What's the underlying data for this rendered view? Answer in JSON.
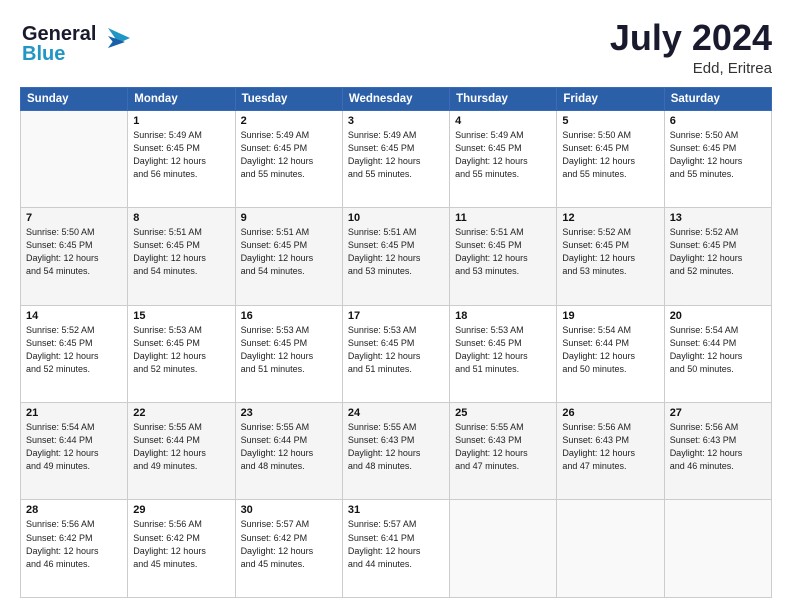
{
  "header": {
    "logo_line1": "General",
    "logo_line2": "Blue",
    "month_year": "July 2024",
    "location": "Edd, Eritrea"
  },
  "days_of_week": [
    "Sunday",
    "Monday",
    "Tuesday",
    "Wednesday",
    "Thursday",
    "Friday",
    "Saturday"
  ],
  "weeks": [
    {
      "shade": false,
      "days": [
        {
          "num": "",
          "empty": true,
          "lines": []
        },
        {
          "num": "1",
          "empty": false,
          "lines": [
            "Sunrise: 5:49 AM",
            "Sunset: 6:45 PM",
            "Daylight: 12 hours",
            "and 56 minutes."
          ]
        },
        {
          "num": "2",
          "empty": false,
          "lines": [
            "Sunrise: 5:49 AM",
            "Sunset: 6:45 PM",
            "Daylight: 12 hours",
            "and 55 minutes."
          ]
        },
        {
          "num": "3",
          "empty": false,
          "lines": [
            "Sunrise: 5:49 AM",
            "Sunset: 6:45 PM",
            "Daylight: 12 hours",
            "and 55 minutes."
          ]
        },
        {
          "num": "4",
          "empty": false,
          "lines": [
            "Sunrise: 5:49 AM",
            "Sunset: 6:45 PM",
            "Daylight: 12 hours",
            "and 55 minutes."
          ]
        },
        {
          "num": "5",
          "empty": false,
          "lines": [
            "Sunrise: 5:50 AM",
            "Sunset: 6:45 PM",
            "Daylight: 12 hours",
            "and 55 minutes."
          ]
        },
        {
          "num": "6",
          "empty": false,
          "lines": [
            "Sunrise: 5:50 AM",
            "Sunset: 6:45 PM",
            "Daylight: 12 hours",
            "and 55 minutes."
          ]
        }
      ]
    },
    {
      "shade": true,
      "days": [
        {
          "num": "7",
          "empty": false,
          "lines": [
            "Sunrise: 5:50 AM",
            "Sunset: 6:45 PM",
            "Daylight: 12 hours",
            "and 54 minutes."
          ]
        },
        {
          "num": "8",
          "empty": false,
          "lines": [
            "Sunrise: 5:51 AM",
            "Sunset: 6:45 PM",
            "Daylight: 12 hours",
            "and 54 minutes."
          ]
        },
        {
          "num": "9",
          "empty": false,
          "lines": [
            "Sunrise: 5:51 AM",
            "Sunset: 6:45 PM",
            "Daylight: 12 hours",
            "and 54 minutes."
          ]
        },
        {
          "num": "10",
          "empty": false,
          "lines": [
            "Sunrise: 5:51 AM",
            "Sunset: 6:45 PM",
            "Daylight: 12 hours",
            "and 53 minutes."
          ]
        },
        {
          "num": "11",
          "empty": false,
          "lines": [
            "Sunrise: 5:51 AM",
            "Sunset: 6:45 PM",
            "Daylight: 12 hours",
            "and 53 minutes."
          ]
        },
        {
          "num": "12",
          "empty": false,
          "lines": [
            "Sunrise: 5:52 AM",
            "Sunset: 6:45 PM",
            "Daylight: 12 hours",
            "and 53 minutes."
          ]
        },
        {
          "num": "13",
          "empty": false,
          "lines": [
            "Sunrise: 5:52 AM",
            "Sunset: 6:45 PM",
            "Daylight: 12 hours",
            "and 52 minutes."
          ]
        }
      ]
    },
    {
      "shade": false,
      "days": [
        {
          "num": "14",
          "empty": false,
          "lines": [
            "Sunrise: 5:52 AM",
            "Sunset: 6:45 PM",
            "Daylight: 12 hours",
            "and 52 minutes."
          ]
        },
        {
          "num": "15",
          "empty": false,
          "lines": [
            "Sunrise: 5:53 AM",
            "Sunset: 6:45 PM",
            "Daylight: 12 hours",
            "and 52 minutes."
          ]
        },
        {
          "num": "16",
          "empty": false,
          "lines": [
            "Sunrise: 5:53 AM",
            "Sunset: 6:45 PM",
            "Daylight: 12 hours",
            "and 51 minutes."
          ]
        },
        {
          "num": "17",
          "empty": false,
          "lines": [
            "Sunrise: 5:53 AM",
            "Sunset: 6:45 PM",
            "Daylight: 12 hours",
            "and 51 minutes."
          ]
        },
        {
          "num": "18",
          "empty": false,
          "lines": [
            "Sunrise: 5:53 AM",
            "Sunset: 6:45 PM",
            "Daylight: 12 hours",
            "and 51 minutes."
          ]
        },
        {
          "num": "19",
          "empty": false,
          "lines": [
            "Sunrise: 5:54 AM",
            "Sunset: 6:44 PM",
            "Daylight: 12 hours",
            "and 50 minutes."
          ]
        },
        {
          "num": "20",
          "empty": false,
          "lines": [
            "Sunrise: 5:54 AM",
            "Sunset: 6:44 PM",
            "Daylight: 12 hours",
            "and 50 minutes."
          ]
        }
      ]
    },
    {
      "shade": true,
      "days": [
        {
          "num": "21",
          "empty": false,
          "lines": [
            "Sunrise: 5:54 AM",
            "Sunset: 6:44 PM",
            "Daylight: 12 hours",
            "and 49 minutes."
          ]
        },
        {
          "num": "22",
          "empty": false,
          "lines": [
            "Sunrise: 5:55 AM",
            "Sunset: 6:44 PM",
            "Daylight: 12 hours",
            "and 49 minutes."
          ]
        },
        {
          "num": "23",
          "empty": false,
          "lines": [
            "Sunrise: 5:55 AM",
            "Sunset: 6:44 PM",
            "Daylight: 12 hours",
            "and 48 minutes."
          ]
        },
        {
          "num": "24",
          "empty": false,
          "lines": [
            "Sunrise: 5:55 AM",
            "Sunset: 6:43 PM",
            "Daylight: 12 hours",
            "and 48 minutes."
          ]
        },
        {
          "num": "25",
          "empty": false,
          "lines": [
            "Sunrise: 5:55 AM",
            "Sunset: 6:43 PM",
            "Daylight: 12 hours",
            "and 47 minutes."
          ]
        },
        {
          "num": "26",
          "empty": false,
          "lines": [
            "Sunrise: 5:56 AM",
            "Sunset: 6:43 PM",
            "Daylight: 12 hours",
            "and 47 minutes."
          ]
        },
        {
          "num": "27",
          "empty": false,
          "lines": [
            "Sunrise: 5:56 AM",
            "Sunset: 6:43 PM",
            "Daylight: 12 hours",
            "and 46 minutes."
          ]
        }
      ]
    },
    {
      "shade": false,
      "days": [
        {
          "num": "28",
          "empty": false,
          "lines": [
            "Sunrise: 5:56 AM",
            "Sunset: 6:42 PM",
            "Daylight: 12 hours",
            "and 46 minutes."
          ]
        },
        {
          "num": "29",
          "empty": false,
          "lines": [
            "Sunrise: 5:56 AM",
            "Sunset: 6:42 PM",
            "Daylight: 12 hours",
            "and 45 minutes."
          ]
        },
        {
          "num": "30",
          "empty": false,
          "lines": [
            "Sunrise: 5:57 AM",
            "Sunset: 6:42 PM",
            "Daylight: 12 hours",
            "and 45 minutes."
          ]
        },
        {
          "num": "31",
          "empty": false,
          "lines": [
            "Sunrise: 5:57 AM",
            "Sunset: 6:41 PM",
            "Daylight: 12 hours",
            "and 44 minutes."
          ]
        },
        {
          "num": "",
          "empty": true,
          "lines": []
        },
        {
          "num": "",
          "empty": true,
          "lines": []
        },
        {
          "num": "",
          "empty": true,
          "lines": []
        }
      ]
    }
  ]
}
